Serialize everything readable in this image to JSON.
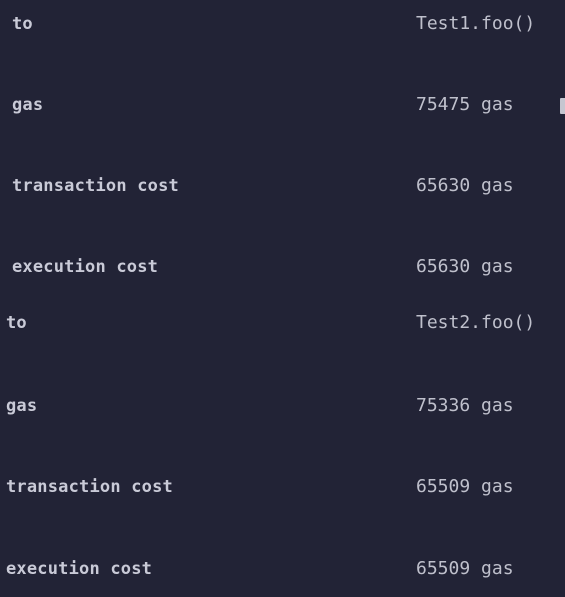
{
  "panels": [
    {
      "rows": [
        {
          "key": "to",
          "value": "Test1.foo()"
        },
        {
          "key": "gas",
          "value": "75475 gas"
        },
        {
          "key": "transaction cost",
          "value": "65630 gas"
        },
        {
          "key": "execution cost",
          "value": "65630 gas"
        }
      ]
    },
    {
      "rows": [
        {
          "key": "to",
          "value": "Test2.foo()"
        },
        {
          "key": "gas",
          "value": "75336 gas"
        },
        {
          "key": "transaction cost",
          "value": "65509 gas"
        },
        {
          "key": "execution cost",
          "value": "65509 gas"
        }
      ]
    }
  ],
  "icons": {
    "copy": "copy-icon"
  },
  "colors": {
    "background": "#222336",
    "key_text": "#c9cad7",
    "value_text": "#bfc0cc"
  }
}
